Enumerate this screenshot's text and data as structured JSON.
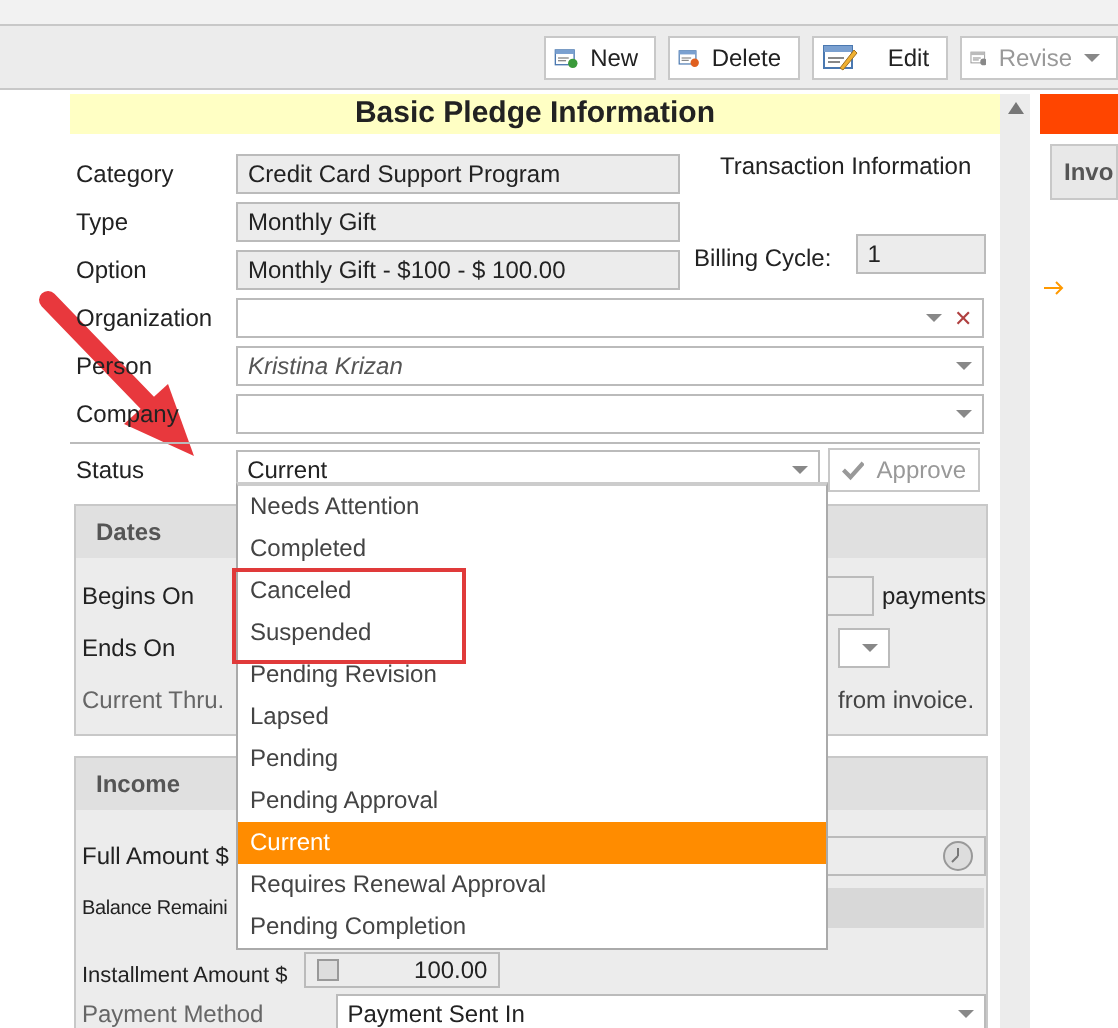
{
  "toolbar": {
    "buttons": [
      {
        "label": "New",
        "kind": "new",
        "disabled": false,
        "dropdown": false
      },
      {
        "label": "Delete",
        "kind": "delete",
        "disabled": false,
        "dropdown": false
      },
      {
        "label": "Edit",
        "kind": "edit",
        "disabled": false,
        "dropdown": false
      },
      {
        "label": "Revise",
        "kind": "revise",
        "disabled": true,
        "dropdown": true
      }
    ]
  },
  "form": {
    "title": "Basic Pledge Information",
    "transaction": {
      "title": "Transaction Information",
      "billing_label": "Billing Cycle:",
      "billing_value": "1"
    },
    "fields": [
      {
        "label": "Category",
        "value": "Credit Card Support Program",
        "kind": "readonly"
      },
      {
        "label": "Type",
        "value": "Monthly Gift",
        "kind": "readonly"
      },
      {
        "label": "Option",
        "value": "Monthly Gift - $100 - $ 100.00",
        "kind": "readonly"
      },
      {
        "label": "Organization",
        "kind": "lookup",
        "clear": "✕"
      },
      {
        "label": "Person",
        "value": "Kristina Krizan",
        "kind": "person"
      },
      {
        "label": "Company",
        "kind": "combo"
      }
    ],
    "status": {
      "label": "Status",
      "value": "Current",
      "approve": {
        "label": "Approve",
        "disabled": true
      }
    },
    "dates": {
      "title": "Dates",
      "begins_label": "Begins On",
      "payments": "payments",
      "ends_label": "Ends On",
      "thru_label": "Current Thru.",
      "thru_note": "from invoice."
    },
    "income": {
      "title": "Income",
      "full_label": "Full Amount $",
      "balance_label": "Balance Remaini",
      "installment_label": "Installment Amount $",
      "installment_value": "100.00",
      "method_label": "Payment Method",
      "method_value": "Payment Sent In"
    }
  },
  "status_dropdown": {
    "items": [
      {
        "label": "Needs Attention",
        "selected": false,
        "highlighted": false
      },
      {
        "label": "Completed",
        "selected": false,
        "highlighted": false
      },
      {
        "label": "Canceled",
        "selected": false,
        "highlighted": true
      },
      {
        "label": "Suspended",
        "selected": false,
        "highlighted": true
      },
      {
        "label": "Pending Revision",
        "selected": false,
        "highlighted": false
      },
      {
        "label": "Lapsed",
        "selected": false,
        "highlighted": false
      },
      {
        "label": "Pending",
        "selected": false,
        "highlighted": false
      },
      {
        "label": "Pending Approval",
        "selected": false,
        "highlighted": false
      },
      {
        "label": "Current",
        "selected": true,
        "highlighted": false
      },
      {
        "label": "Requires Renewal Approval",
        "selected": false,
        "highlighted": false
      },
      {
        "label": "Pending Completion",
        "selected": false,
        "highlighted": false
      }
    ]
  },
  "right_panel": {
    "tab": "Invo"
  }
}
